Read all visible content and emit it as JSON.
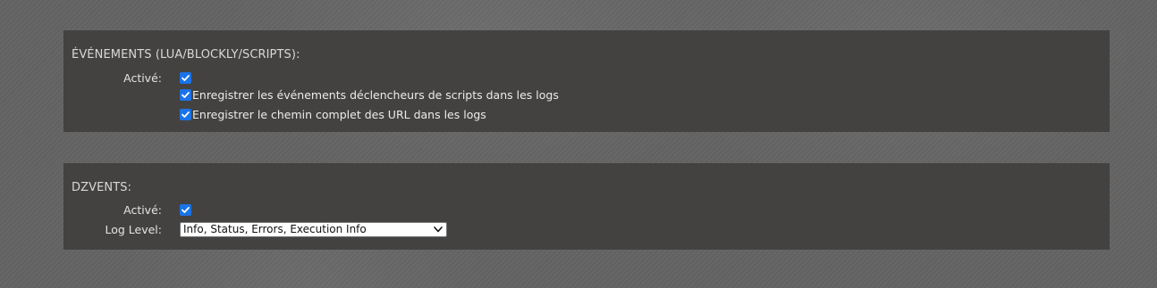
{
  "events_section": {
    "title": "ÉVÉNEMENTS (LUA/BLOCKLY/SCRIPTS):",
    "enabled_label": "Activé:",
    "enabled_checked": true,
    "log_triggers_label": "Enregistrer les événements déclencheurs de scripts dans les logs",
    "log_triggers_checked": true,
    "log_full_url_label": "Enregistrer le chemin complet des URL dans les logs",
    "log_full_url_checked": true
  },
  "dzvents_section": {
    "title": "DZVENTS:",
    "enabled_label": "Activé:",
    "enabled_checked": true,
    "log_level_label": "Log Level:",
    "log_level_value": "Info, Status, Errors, Execution Info"
  },
  "colors": {
    "panel_bg": "#444240",
    "page_bg": "#636363",
    "checkbox_accent": "#1a73e8"
  },
  "icons": {
    "checkbox": "checkmark-icon",
    "select_arrow": "chevron-down-icon"
  }
}
